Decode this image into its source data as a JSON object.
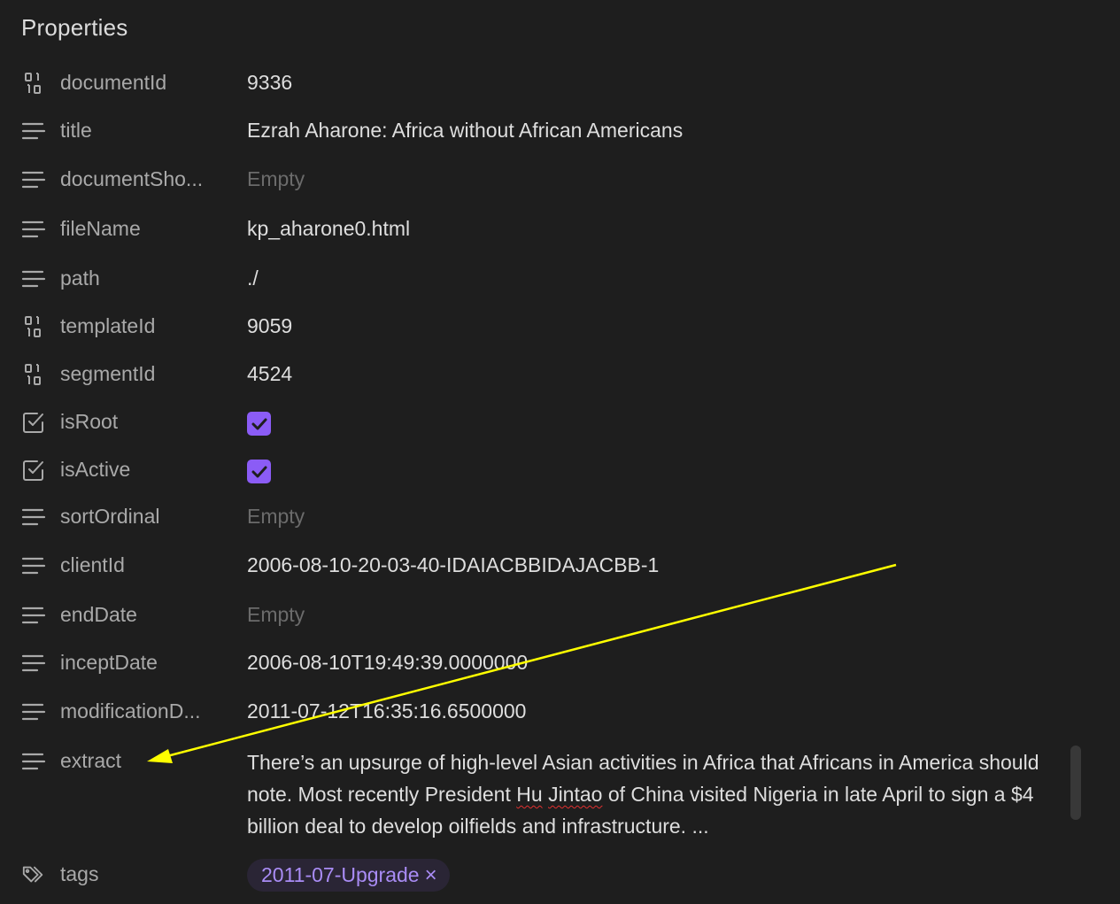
{
  "panel": {
    "title": "Properties"
  },
  "properties": [
    {
      "key": "documentId",
      "icon": "binary-number-icon",
      "value": "9336",
      "type": "number"
    },
    {
      "key": "title",
      "icon": "text-lines-icon",
      "value": "Ezrah Aharone: Africa without African Americans",
      "type": "text"
    },
    {
      "key": "documentSho...",
      "icon": "text-lines-icon",
      "value": "Empty",
      "type": "empty"
    },
    {
      "key": "fileName",
      "icon": "text-lines-icon",
      "value": "kp_aharone0.html",
      "type": "text"
    },
    {
      "key": "path",
      "icon": "text-lines-icon",
      "value": "./",
      "type": "text"
    },
    {
      "key": "templateId",
      "icon": "binary-number-icon",
      "value": "9059",
      "type": "number"
    },
    {
      "key": "segmentId",
      "icon": "binary-number-icon",
      "value": "4524",
      "type": "number"
    },
    {
      "key": "isRoot",
      "icon": "checkbox-icon",
      "value": true,
      "type": "checkbox"
    },
    {
      "key": "isActive",
      "icon": "checkbox-icon",
      "value": true,
      "type": "checkbox"
    },
    {
      "key": "sortOrdinal",
      "icon": "text-lines-icon",
      "value": "Empty",
      "type": "empty"
    },
    {
      "key": "clientId",
      "icon": "text-lines-icon",
      "value": "2006-08-10-20-03-40-IDAIACBBIDAJACBB-1",
      "type": "text"
    },
    {
      "key": "endDate",
      "icon": "text-lines-icon",
      "value": "Empty",
      "type": "empty"
    },
    {
      "key": "inceptDate",
      "icon": "text-lines-icon",
      "value": "2006-08-10T19:49:39.0000000",
      "type": "text"
    },
    {
      "key": "modificationD...",
      "icon": "text-lines-icon",
      "value": "2011-07-12T16:35:16.6500000",
      "type": "text"
    }
  ],
  "extract": {
    "key": "extract",
    "icon": "text-lines-icon",
    "text_before": "There’s an upsurge of high-level Asian activities in Africa that Africans in America should note. Most recently President ",
    "misspelled_1": "Hu",
    "space": " ",
    "misspelled_2": "Jintao",
    "text_after": " of China visited Nigeria in late April to sign a $4 billion deal to develop oilfields and infrastructure. ..."
  },
  "tags": {
    "key": "tags",
    "icon": "tags-icon",
    "items": [
      {
        "label": "2011-07-Upgrade",
        "remove": "×"
      }
    ]
  },
  "colors": {
    "background": "#1e1e1e",
    "accent": "#8b5cf6",
    "tag_text": "#a98cf5",
    "annotation_arrow": "#ffff00"
  }
}
